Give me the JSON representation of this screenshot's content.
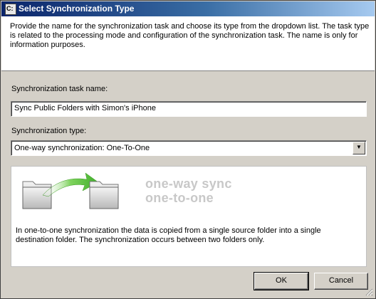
{
  "window": {
    "title": "Select Synchronization Type",
    "icon_text": "C:"
  },
  "header": {
    "description": "Provide the name for the synchronization task and choose its type from the dropdown list. The task type is related to the processing mode and configuration of the synchronization task. The name is only for information purposes."
  },
  "task_name": {
    "label": "Synchronization task name:",
    "value": "Sync Public Folders with Simon's iPhone"
  },
  "sync_type": {
    "label": "Synchronization type:",
    "selected": "One-way synchronization: One-To-One"
  },
  "illustration": {
    "line1": "one-way sync",
    "line2": "one-to-one",
    "icons": [
      "source-folder-icon",
      "arrow-icon",
      "destination-folder-icon"
    ],
    "description": "In one-to-one synchronization the data is copied from a single source folder into a single destination folder. The synchronization occurs between two folders only."
  },
  "buttons": {
    "ok": "OK",
    "cancel": "Cancel"
  },
  "colors": {
    "title_bar_start": "#0a246a",
    "title_bar_end": "#a6caf0",
    "dialog_face": "#d4d0c8",
    "arrow_green": "#3fae2a"
  }
}
